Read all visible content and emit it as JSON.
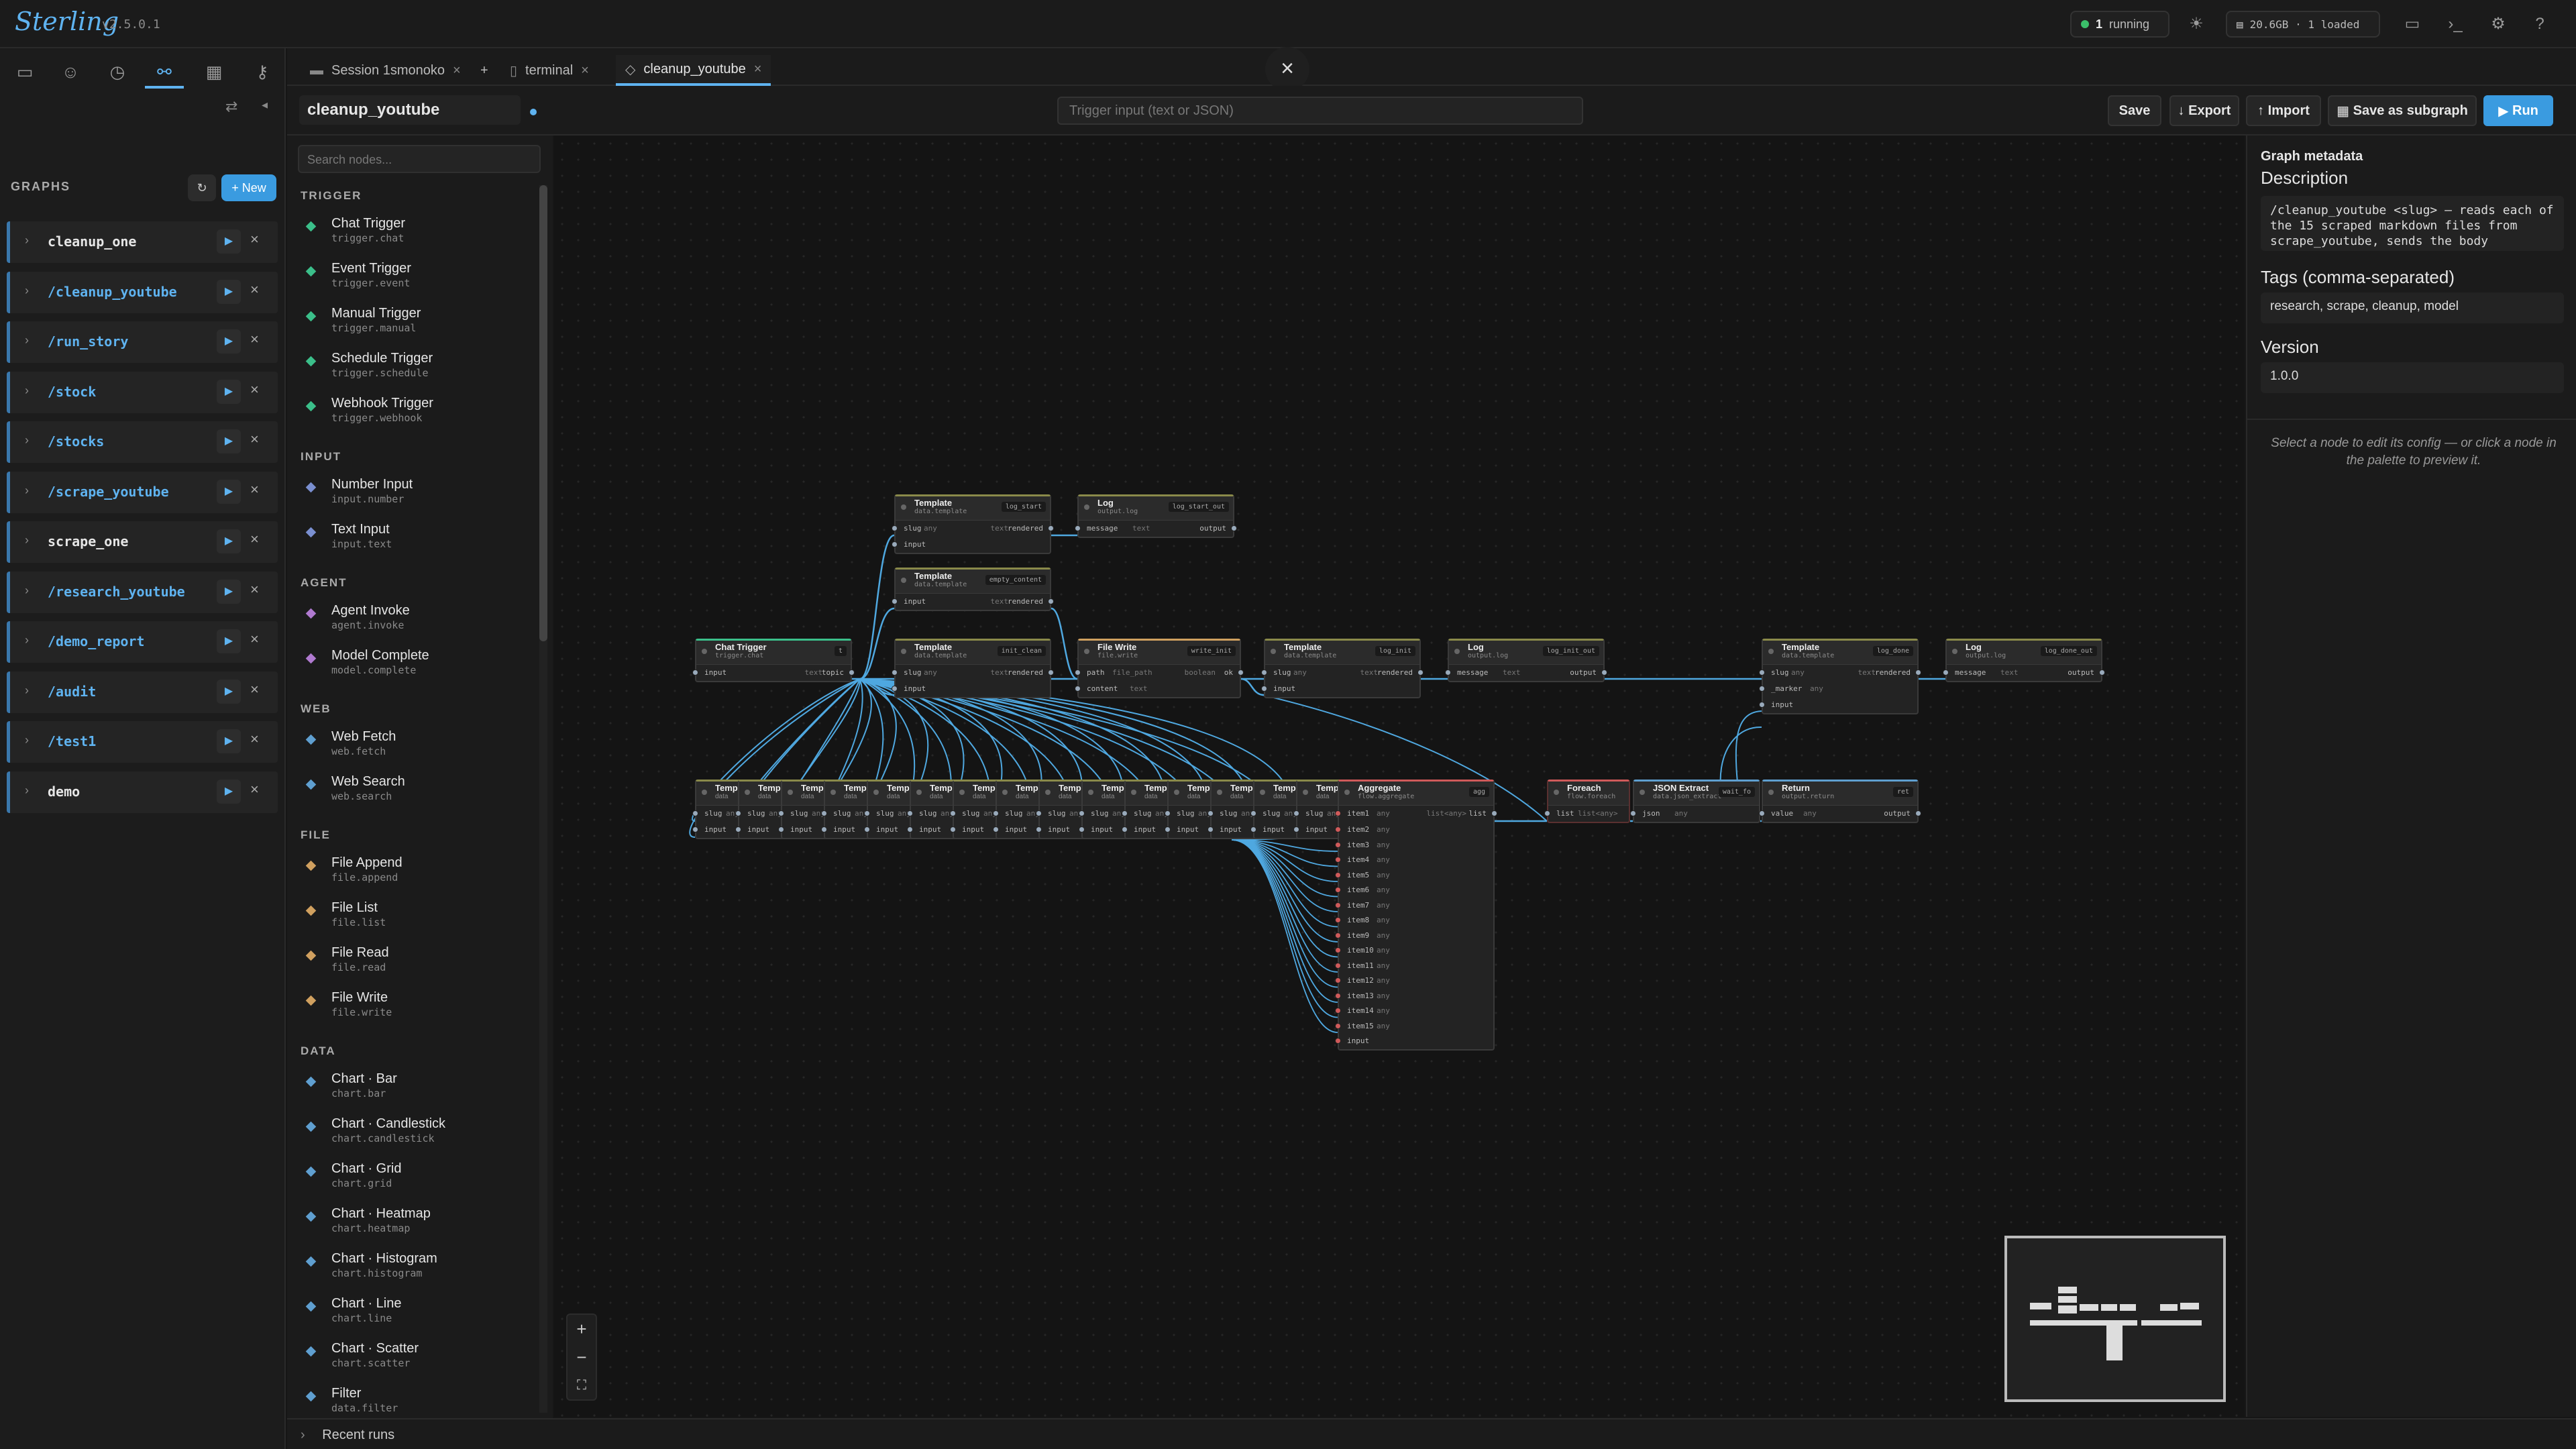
{
  "app": {
    "name": "Sterling",
    "version": "v2.5.0.1"
  },
  "topbar": {
    "running_count": "1",
    "running_label": "running",
    "memory": "20.6GB · 1 loaded",
    "theme_icon": "sun-icon"
  },
  "leftnav": {
    "icons": [
      "folder-icon",
      "user-icon",
      "history-icon",
      "graph-icon",
      "calendar-icon",
      "key-icon"
    ]
  },
  "graphs": {
    "heading": "GRAPHS",
    "new_label": "+ New",
    "items": [
      {
        "name": "cleanup_one",
        "slash": false
      },
      {
        "name": "/cleanup_youtube",
        "slash": true
      },
      {
        "name": "/run_story",
        "slash": true
      },
      {
        "name": "/stock",
        "slash": true
      },
      {
        "name": "/stocks",
        "slash": true
      },
      {
        "name": "/scrape_youtube",
        "slash": true
      },
      {
        "name": "scrape_one",
        "slash": false
      },
      {
        "name": "/research_youtube",
        "slash": true
      },
      {
        "name": "/demo_report",
        "slash": true
      },
      {
        "name": "/audit",
        "slash": true
      },
      {
        "name": "/test1",
        "slash": true
      },
      {
        "name": "demo",
        "slash": false
      }
    ]
  },
  "palette": {
    "search_placeholder": "Search nodes...",
    "sections": [
      {
        "title": "TRIGGER",
        "color": "#3bbf8a",
        "items": [
          {
            "t": "Chat Trigger",
            "s": "trigger.chat"
          },
          {
            "t": "Event Trigger",
            "s": "trigger.event"
          },
          {
            "t": "Manual Trigger",
            "s": "trigger.manual"
          },
          {
            "t": "Schedule Trigger",
            "s": "trigger.schedule"
          },
          {
            "t": "Webhook Trigger",
            "s": "trigger.webhook"
          }
        ]
      },
      {
        "title": "INPUT",
        "color": "#7a8fd0",
        "items": [
          {
            "t": "Number Input",
            "s": "input.number"
          },
          {
            "t": "Text Input",
            "s": "input.text"
          }
        ]
      },
      {
        "title": "AGENT",
        "color": "#b07ad0",
        "items": [
          {
            "t": "Agent Invoke",
            "s": "agent.invoke"
          },
          {
            "t": "Model Complete",
            "s": "model.complete"
          }
        ]
      },
      {
        "title": "WEB",
        "color": "#5f9fd0",
        "items": [
          {
            "t": "Web Fetch",
            "s": "web.fetch"
          },
          {
            "t": "Web Search",
            "s": "web.search"
          }
        ]
      },
      {
        "title": "FILE",
        "color": "#d0a05f",
        "items": [
          {
            "t": "File Append",
            "s": "file.append"
          },
          {
            "t": "File List",
            "s": "file.list"
          },
          {
            "t": "File Read",
            "s": "file.read"
          },
          {
            "t": "File Write",
            "s": "file.write"
          }
        ]
      },
      {
        "title": "DATA",
        "color": "#5f9fd0",
        "items": [
          {
            "t": "Chart · Bar",
            "s": "chart.bar"
          },
          {
            "t": "Chart · Candlestick",
            "s": "chart.candlestick"
          },
          {
            "t": "Chart · Grid",
            "s": "chart.grid"
          },
          {
            "t": "Chart · Heatmap",
            "s": "chart.heatmap"
          },
          {
            "t": "Chart · Histogram",
            "s": "chart.histogram"
          },
          {
            "t": "Chart · Line",
            "s": "chart.line"
          },
          {
            "t": "Chart · Scatter",
            "s": "chart.scatter"
          },
          {
            "t": "Filter",
            "s": "data.filter"
          }
        ]
      }
    ]
  },
  "tabs": [
    {
      "label": "Session 1smonoko",
      "active": false
    },
    {
      "label": "terminal",
      "active": false
    },
    {
      "label": "cleanup_youtube",
      "active": true
    }
  ],
  "toolbar": {
    "graph_name": "cleanup_youtube",
    "trigger_placeholder": "Trigger input (text or JSON)",
    "save": "Save",
    "export": "Export",
    "import": "Import",
    "save_subgraph": "Save as subgraph",
    "run": "Run"
  },
  "inspector": {
    "heading": "Graph metadata",
    "description_label": "Description",
    "description": "/cleanup_youtube <slug> — reads each of the 15 scraped markdown files from scrape_youtube, sends the body",
    "tags_label": "Tags (comma-separated)",
    "tags": "research, scrape, cleanup, model",
    "version_label": "Version",
    "version": "1.0.0",
    "hint": "Select a node to edit its config — or click a node in the palette to preview it."
  },
  "nodes": {
    "chat_trigger": {
      "t": "Chat Trigger",
      "s": "trigger.chat",
      "tag": "t",
      "in": "input",
      "out_type": "text",
      "out": "topic"
    },
    "tpl_start": {
      "t": "Template",
      "s": "data.template",
      "tag": "log_start",
      "in1": "slug",
      "in1t": "any",
      "out_type": "text",
      "out": "rendered",
      "in2": "input"
    },
    "log_start": {
      "t": "Log",
      "s": "output.log",
      "tag": "log_start_out",
      "in1": "message",
      "in1t": "text",
      "out": "output"
    },
    "tpl_empty": {
      "t": "Template",
      "s": "data.template",
      "tag": "empty_content",
      "in1": "input",
      "out_type": "text",
      "out": "rendered"
    },
    "tpl_init": {
      "t": "Template",
      "s": "data.template",
      "tag": "init_clean",
      "in1": "slug",
      "in1t": "any",
      "out_type": "text",
      "out": "rendered",
      "in2": "input"
    },
    "file_write": {
      "t": "File Write",
      "s": "file.write",
      "tag": "write_init",
      "in1": "path",
      "in1t": "file_path",
      "out_type": "boolean",
      "out": "ok",
      "in2": "content",
      "in2t": "text"
    },
    "tpl_log_init": {
      "t": "Template",
      "s": "data.template",
      "tag": "log_init",
      "in1": "slug",
      "in1t": "any",
      "out_type": "text",
      "out": "rendered",
      "in2": "input"
    },
    "log_init": {
      "t": "Log",
      "s": "output.log",
      "tag": "log_init_out",
      "in1": "message",
      "in1t": "text",
      "out": "output"
    },
    "tpl_done": {
      "t": "Template",
      "s": "data.template",
      "tag": "log_done",
      "in1": "slug",
      "in1t": "any",
      "out_type": "text",
      "out": "rendered",
      "in2": "_marker",
      "in2t": "any",
      "in3": "input"
    },
    "log_done": {
      "t": "Log",
      "s": "output.log",
      "tag": "log_done_out",
      "in1": "message",
      "in1t": "text",
      "out": "output"
    },
    "aggregate": {
      "t": "Aggregate",
      "s": "flow.aggregate",
      "tag": "agg",
      "out_type": "list<any>",
      "out": "list",
      "items": [
        "item1",
        "item2",
        "item3",
        "item4",
        "item5",
        "item6",
        "item7",
        "item8",
        "item9",
        "item10",
        "item11",
        "item12",
        "item13",
        "item14",
        "item15"
      ],
      "item_type": "any",
      "last": "input"
    },
    "foreach": {
      "t": "Foreach",
      "s": "flow.foreach",
      "in1": "list",
      "in1t": "list<any>"
    },
    "json_extract": {
      "t": "JSON Extract",
      "s": "data.json_extract",
      "tag": "wait_fo",
      "in1": "json",
      "in1t": "any"
    },
    "ret": {
      "t": "Return",
      "s": "output.return",
      "tag": "ret",
      "in1": "value",
      "in1t": "any",
      "out": "output"
    },
    "mini": {
      "t": "Temp",
      "s": "data",
      "slug": "slug",
      "any": "any",
      "input": "input"
    }
  },
  "recent_runs": "Recent runs",
  "zoom": {
    "in": "+",
    "out": "−",
    "fit": "⛶"
  },
  "colors": {
    "accent": "#5fb3f0",
    "edge": "#4fa8e0",
    "edge_red": "#d05a5a"
  }
}
